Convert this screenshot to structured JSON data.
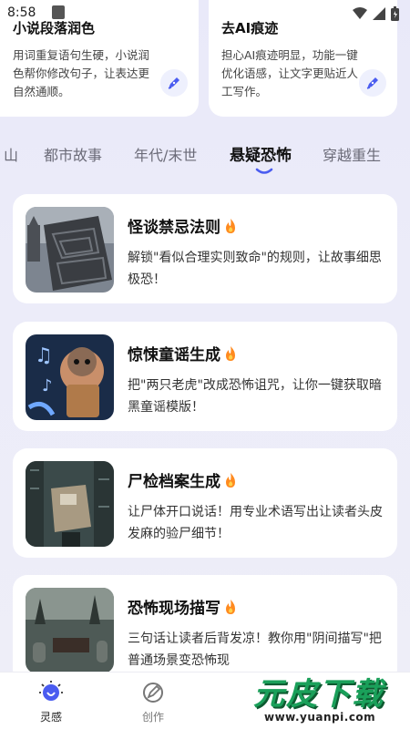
{
  "status_bar": {
    "time": "8:58"
  },
  "tools": [
    {
      "title": "小说段落润色",
      "desc": "用词重复语句生硬，小说润色帮你修改句子，让表达更自然通顺。"
    },
    {
      "title": "去AI痕迹",
      "desc": "担心AI痕迹明显，功能一键优化语感，让文字更贴近人工写作。"
    }
  ],
  "tabs": [
    {
      "label": "山"
    },
    {
      "label": "都市故事"
    },
    {
      "label": "年代/末世"
    },
    {
      "label": "悬疑恐怖",
      "active": true
    },
    {
      "label": "穿越重生"
    }
  ],
  "stories": [
    {
      "title": "怪谈禁忌法则",
      "desc": "解锁\"看似合理实则致命\"的规则，让故事细思极恐！",
      "icon": "fire-icon"
    },
    {
      "title": "惊悚童谣生成",
      "desc": "把\"两只老虎\"改成恐怖诅咒，让你一键获取暗黑童谣模版！",
      "icon": "fire-icon"
    },
    {
      "title": "尸检档案生成",
      "desc": "让尸体开口说话！用专业术语写出让读者头皮发麻的验尸细节！",
      "icon": "fire-icon"
    },
    {
      "title": "恐怖现场描写",
      "desc": "三句话让读者后背发凉！教你用\"阴间描写\"把普通场景变恐怖现",
      "icon": "fire-icon"
    }
  ],
  "nav": [
    {
      "label": "灵感",
      "active": true
    },
    {
      "label": "创作"
    }
  ],
  "watermark": {
    "brand": "元皮下载",
    "url": "www.yuanpi.com"
  },
  "colors": {
    "accent": "#4a5cf0",
    "fire": "#ff8a1f",
    "watermark_green": "#1aa05a"
  }
}
